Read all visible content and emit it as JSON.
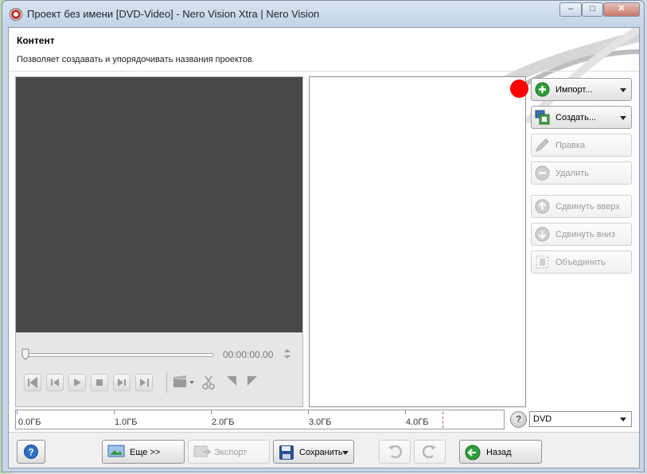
{
  "window": {
    "title": "Проект без имени [DVD-Video] - Nero Vision Xtra | Nero Vision",
    "minimize": "–",
    "maximize": "□",
    "close": "✕"
  },
  "section": {
    "title": "Контент",
    "description": "Позволяет создавать и упорядочивать названия проектов."
  },
  "preview": {
    "timecode": "00:00:00.00"
  },
  "actions": {
    "import": "Импорт...",
    "create": "Создать...",
    "edit": "Правка",
    "delete": "Удалить",
    "move_up": "Сдвинуть вверх",
    "move_down": "Сдвинуть вниз",
    "merge": "Объединить"
  },
  "capacity": {
    "labels": [
      "0.0ГБ",
      "1.0ГБ",
      "2.0ГБ",
      "3.0ГБ",
      "4.0ГБ"
    ],
    "used_fraction": 0
  },
  "disc_type": {
    "selected": "DVD",
    "help": "?"
  },
  "footer": {
    "help": "?",
    "more": "Еще >>",
    "export": "Экспорт",
    "save": "Сохранить",
    "back": "Назад"
  },
  "colors": {
    "accent_green": "#2e9e3a",
    "red_marker": "#ff0000",
    "preview_bg": "#484848"
  }
}
